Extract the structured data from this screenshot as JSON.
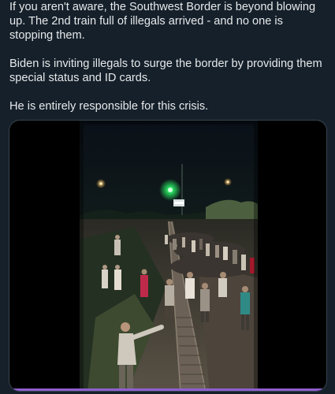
{
  "tweet": {
    "paragraphs": [
      "If you aren't aware, the Southwest Border is beyond blowing up. The 2nd train full of illegals arrived - and no one is stopping them.",
      "Biden is inviting illegals to surge the border by providing them special status and ID cards.",
      "He is entirely responsible for this crisis."
    ]
  },
  "media": {
    "type": "video",
    "progress": 1.0,
    "progress_color": "#8f5fd1"
  },
  "colors": {
    "background": "#15202b",
    "text": "#e7e9ea",
    "card_border": "#38444d",
    "signal_green": "#2bff6a"
  }
}
